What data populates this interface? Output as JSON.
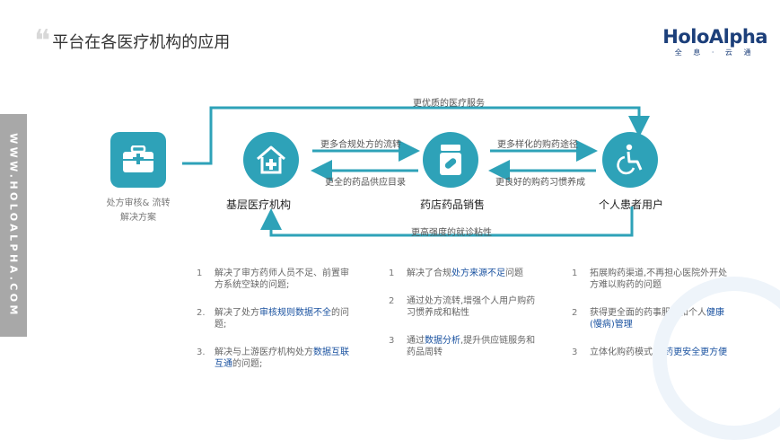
{
  "header": {
    "quote_mark": "❝",
    "title": "平台在各医疗机构的应用"
  },
  "logo": {
    "name": "HoloAlpha",
    "tagline": "全 息 · 云 通"
  },
  "side": {
    "text": "WWW.HOLOALPHA.COM"
  },
  "diagram": {
    "top_flow": "更优质的医疗服务",
    "bottom_flow": "更高强度的就诊粘性",
    "arrow_1_2_top": "更多合规处方的流转",
    "arrow_2_1_bottom": "更全的药品供应目录",
    "arrow_2_3_top": "更多样化的购药途径",
    "arrow_3_2_bottom": "更良好的购药习惯养成",
    "solution_label_1": "处方审核& 流转",
    "solution_label_2": "解决方案",
    "node_1": "基层医疗机构",
    "node_2": "药店药品销售",
    "node_3": "个人患者用户"
  },
  "col1": [
    {
      "n": "1",
      "pre": "解决了审方药师人员不足",
      "hl": "",
      "post": "、前置审方系统空缺的问题;"
    },
    {
      "n": "2.",
      "pre": "解决了处方",
      "hl": "审核规则数据不全",
      "post": "的问题;"
    },
    {
      "n": "3.",
      "pre": "解决与上游医疗机构处方",
      "hl": "数据互联互通",
      "post": "的问题;"
    }
  ],
  "col2": [
    {
      "n": "1",
      "pre": "解决了合规",
      "hl": "处方来源不足",
      "post": "问题"
    },
    {
      "n": "2",
      "pre": "通过处方流转,增强个人用户购药习惯养成和粘性",
      "hl": "",
      "post": ""
    },
    {
      "n": "3",
      "pre": "通过",
      "hl": "数据分析",
      "post": ",提升供应链服务和药品周转"
    }
  ],
  "col3": [
    {
      "n": "1",
      "pre": "拓展购药渠道,不再担心医院外开处方难以购药的问题",
      "hl": "",
      "post": ""
    },
    {
      "n": "2",
      "pre": "获得更全面的药事服务和个人",
      "hl": "健康(慢病)管理",
      "post": ""
    },
    {
      "n": "3",
      "pre": "立体化购药模式,",
      "hl": "用药更安全更方便",
      "post": ""
    }
  ],
  "colors": {
    "accent": "#2ea2b8",
    "highlight": "#1a52a0",
    "logo": "#1c3f7a"
  }
}
